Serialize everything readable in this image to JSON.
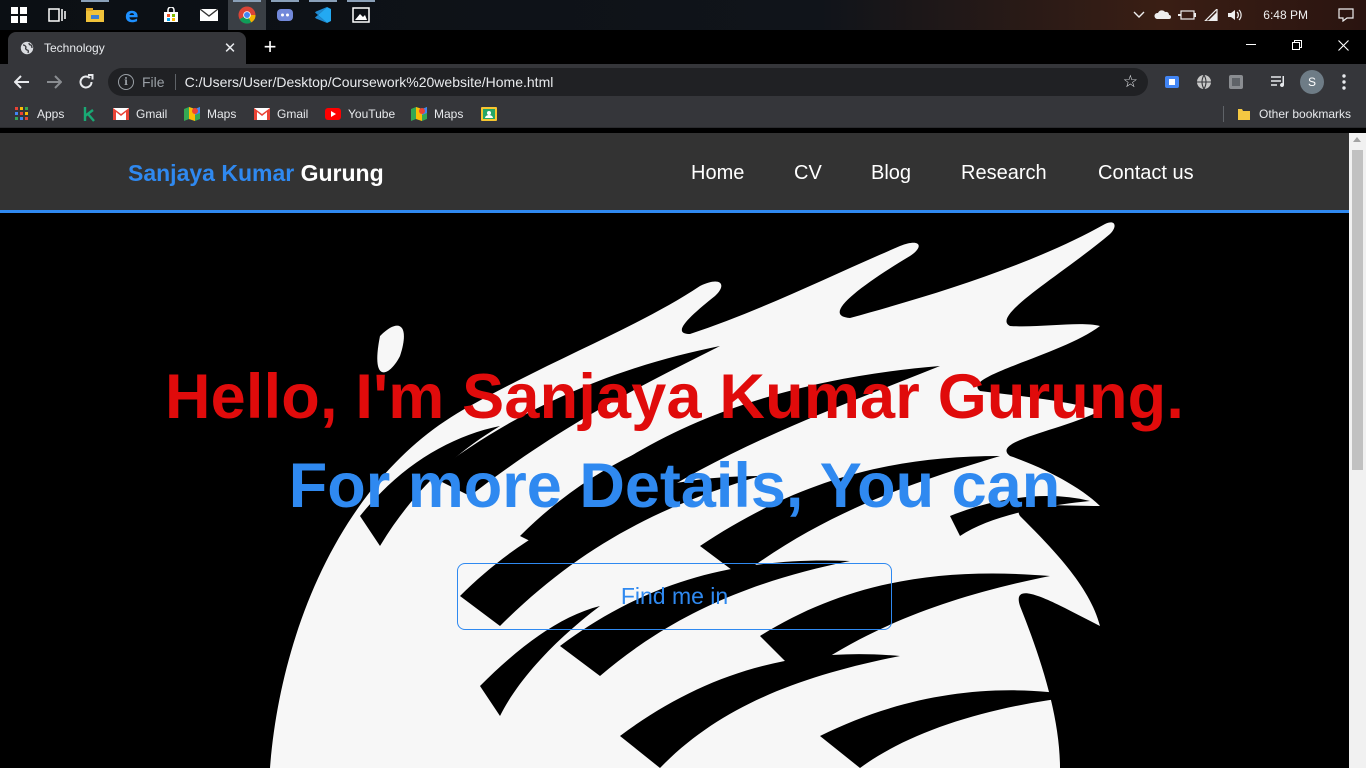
{
  "taskbar": {
    "apps": [
      {
        "name": "start-icon",
        "active": false
      },
      {
        "name": "task-view-icon",
        "active": false
      },
      {
        "name": "file-explorer-icon",
        "active": false
      },
      {
        "name": "edge-icon",
        "active": false
      },
      {
        "name": "store-icon",
        "active": false
      },
      {
        "name": "mail-icon",
        "active": false
      },
      {
        "name": "chrome-icon",
        "active": true
      },
      {
        "name": "discord-icon",
        "active": false
      },
      {
        "name": "vscode-icon",
        "active": false
      },
      {
        "name": "photos-icon",
        "active": false
      }
    ],
    "time": "6:48 PM"
  },
  "browser": {
    "tab_title": "Technology",
    "new_tab": "+",
    "url_scheme": "File",
    "url": "C:/Users/User/Desktop/Coursework%20website/Home.html",
    "profile_initial": "S"
  },
  "bookmarks": [
    {
      "label": "Apps",
      "icon": "apps-grid-icon"
    },
    {
      "label": "",
      "icon": "k-icon"
    },
    {
      "label": "Gmail",
      "icon": "gmail-icon"
    },
    {
      "label": "Maps",
      "icon": "maps-icon"
    },
    {
      "label": "Gmail",
      "icon": "gmail-icon"
    },
    {
      "label": "YouTube",
      "icon": "youtube-icon"
    },
    {
      "label": "Maps",
      "icon": "maps-icon"
    },
    {
      "label": "",
      "icon": "classroom-icon"
    }
  ],
  "other_bookmarks": "Other bookmarks",
  "site": {
    "brand_first": "Sanjaya Kumar",
    "brand_last": "Gurung",
    "nav": [
      "Home",
      "CV",
      "Blog",
      "Research",
      "Contact us"
    ],
    "hero_title": "Hello, I'm Sanjaya Kumar Gurung.",
    "hero_subtitle": "For more Details, You can",
    "cta_label": "Find me in"
  },
  "colors": {
    "accent_blue": "#2f89f0",
    "hero_red": "#e00b0b",
    "header_bg": "#333333"
  }
}
